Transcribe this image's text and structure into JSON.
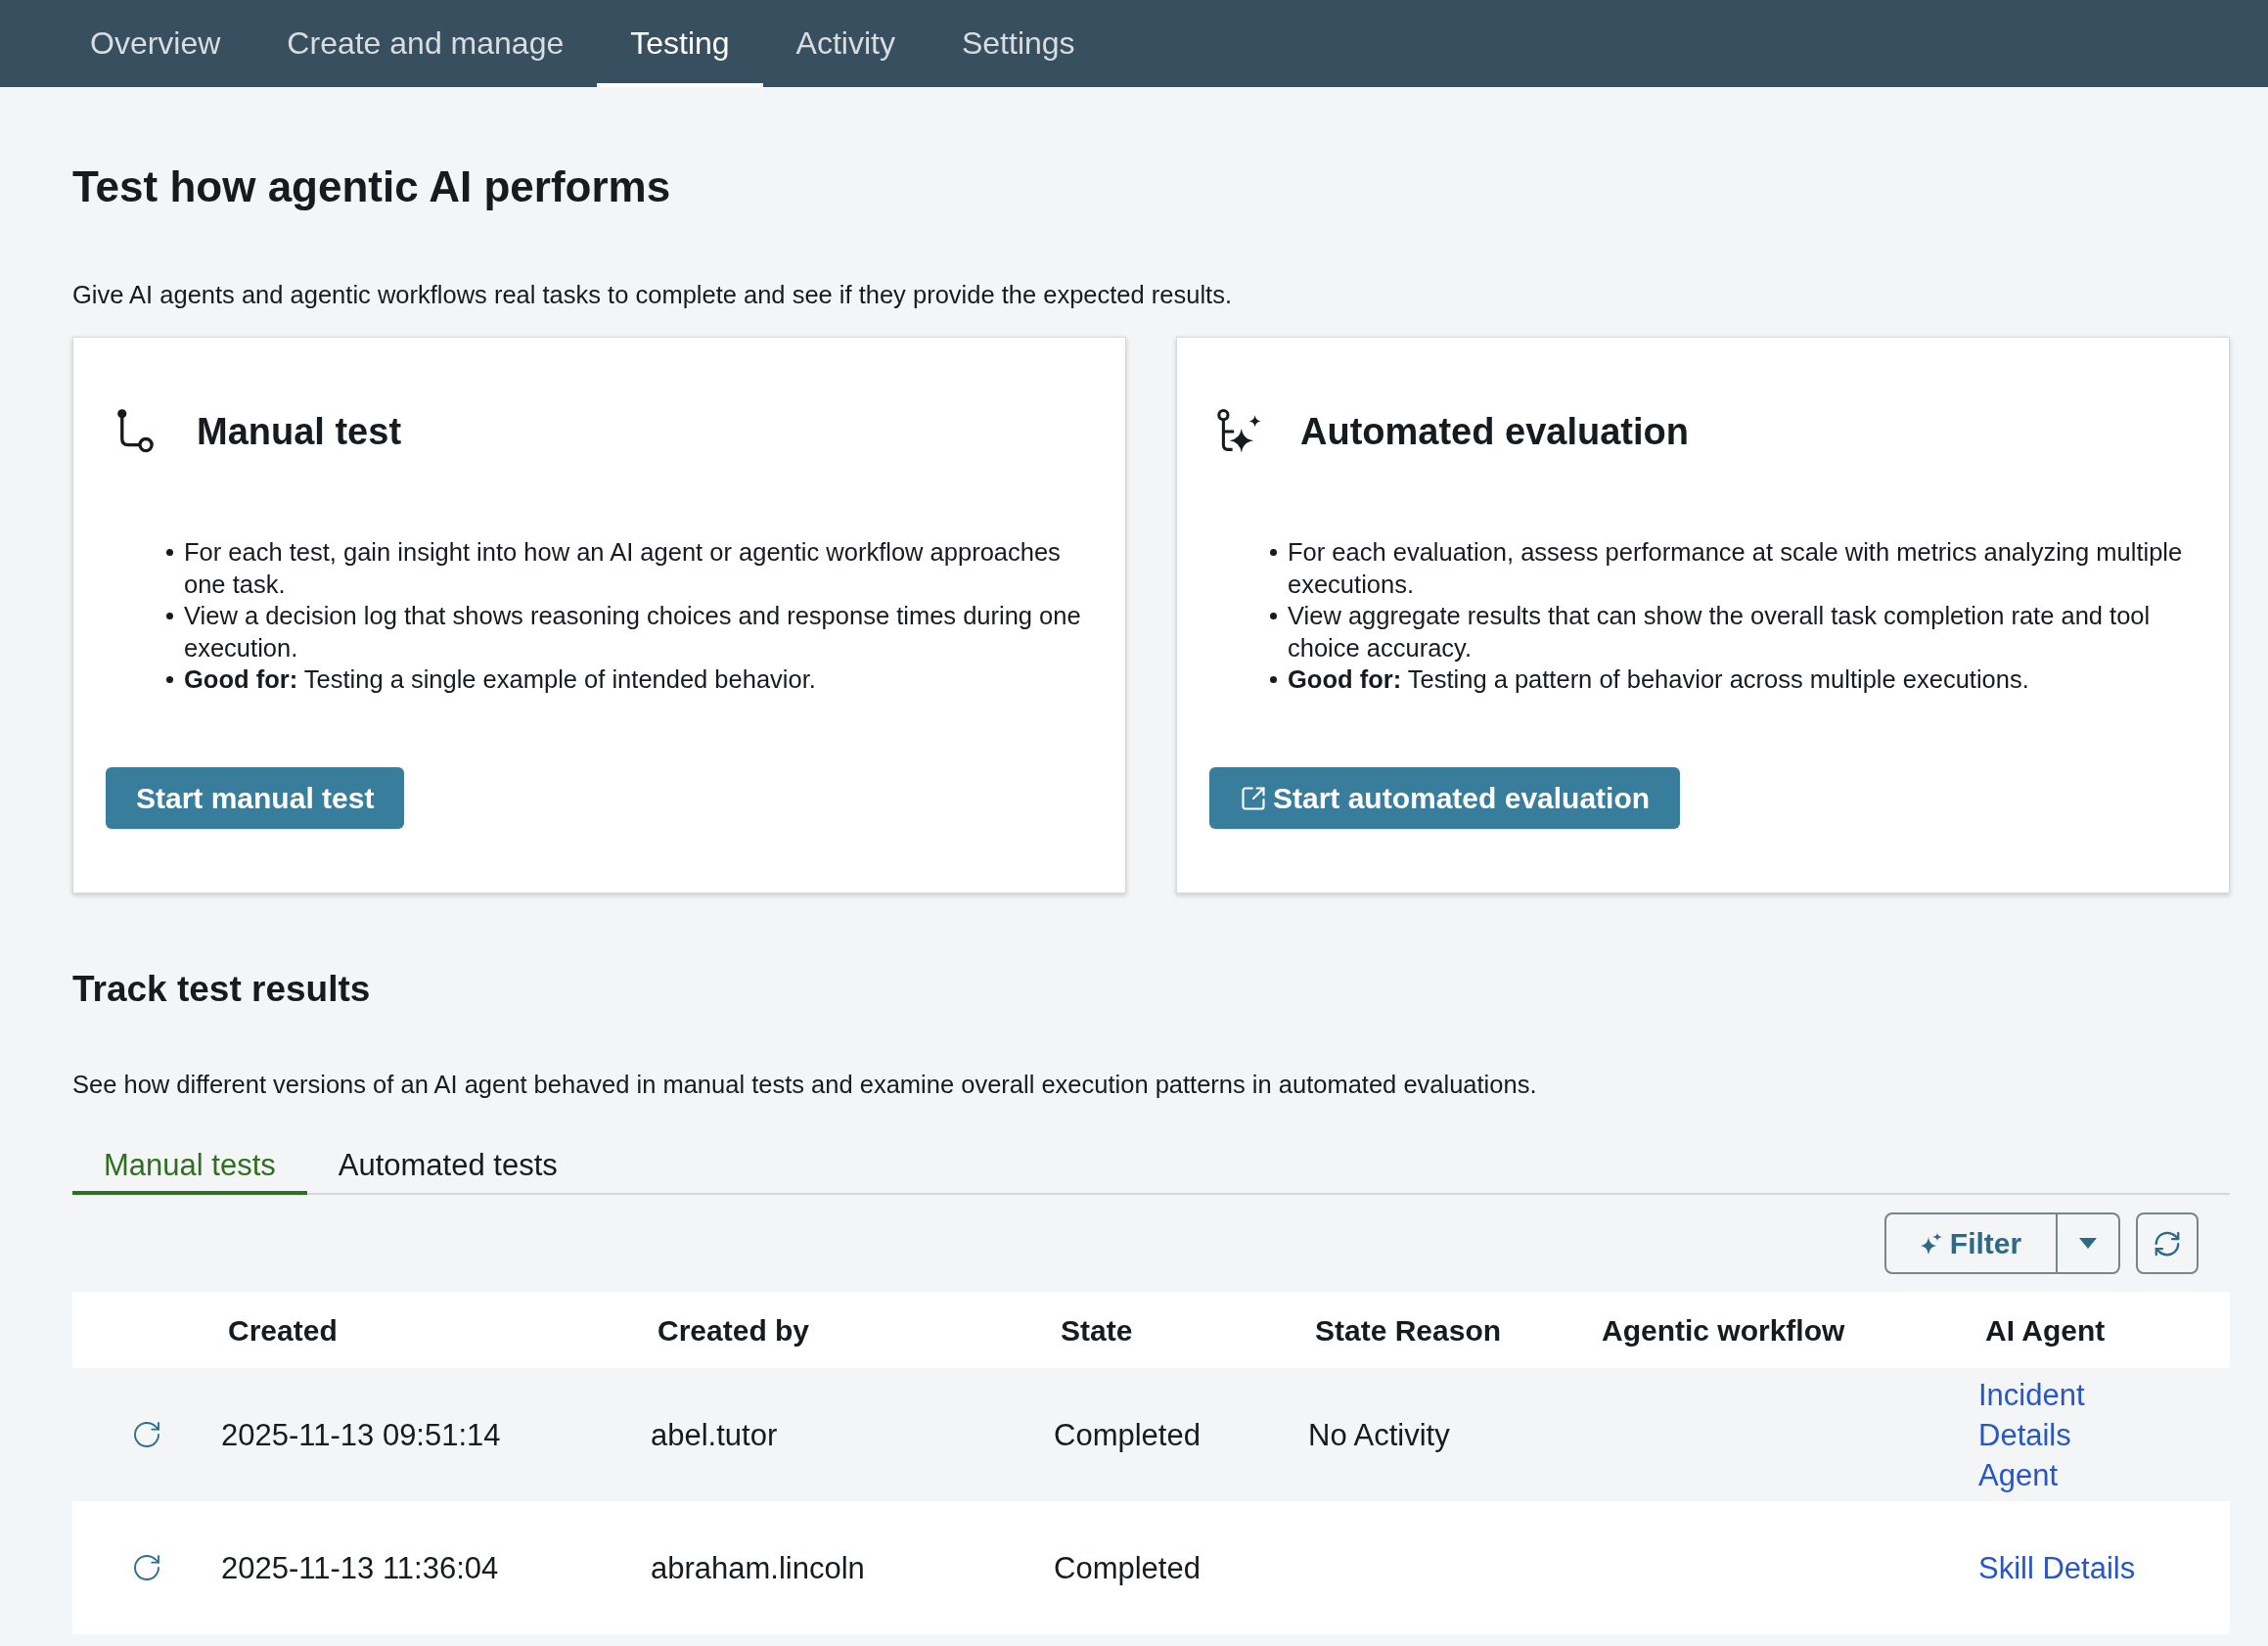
{
  "nav": {
    "tabs": [
      {
        "label": "Overview",
        "selected": false
      },
      {
        "label": "Create and manage",
        "selected": false
      },
      {
        "label": "Testing",
        "selected": true
      },
      {
        "label": "Activity",
        "selected": false
      },
      {
        "label": "Settings",
        "selected": false
      }
    ]
  },
  "page": {
    "title": "Test how agentic AI performs",
    "description": "Give AI agents and agentic workflows real tasks to complete and see if they provide the expected results."
  },
  "cards": [
    {
      "kind": "manual",
      "title": "Manual test",
      "bullets": [
        "For each test, gain insight into how an AI agent or agentic workflow approaches one task.",
        "View a decision log that shows reasoning choices and response times during one execution.",
        "**Good for:** Testing a single example of intended behavior."
      ],
      "button": {
        "label": "Start manual test",
        "external": false
      }
    },
    {
      "kind": "automated",
      "title": "Automated evaluation",
      "bullets": [
        "For each evaluation, assess performance at scale with metrics analyzing multiple executions.",
        "View aggregate results that can show the overall task completion rate and tool choice accuracy.",
        "**Good for:** Testing a pattern of behavior across multiple executions."
      ],
      "button": {
        "label": "Start automated evaluation",
        "external": true
      }
    }
  ],
  "results": {
    "title": "Track test results",
    "description": "See how different versions of an AI agent behaved in manual tests and examine overall execution patterns in automated evaluations.",
    "tabs": [
      {
        "label": "Manual tests",
        "selected": true
      },
      {
        "label": "Automated tests",
        "selected": false
      }
    ],
    "filter": {
      "label": "Filter"
    },
    "table": {
      "columns": [
        "Created",
        "Created by",
        "State",
        "State Reason",
        "Agentic workflow",
        "AI Agent"
      ],
      "rows": [
        {
          "created": "2025-11-13 09:51:14",
          "created_by": "abel.tutor",
          "state": "Completed",
          "state_reason": "No Activity",
          "ai_agent": "Incident Details Agent"
        },
        {
          "created": "2025-11-13 11:36:04",
          "created_by": "abraham.lincoln",
          "state": "Completed",
          "ai_agent": "Skill Details"
        }
      ]
    }
  }
}
